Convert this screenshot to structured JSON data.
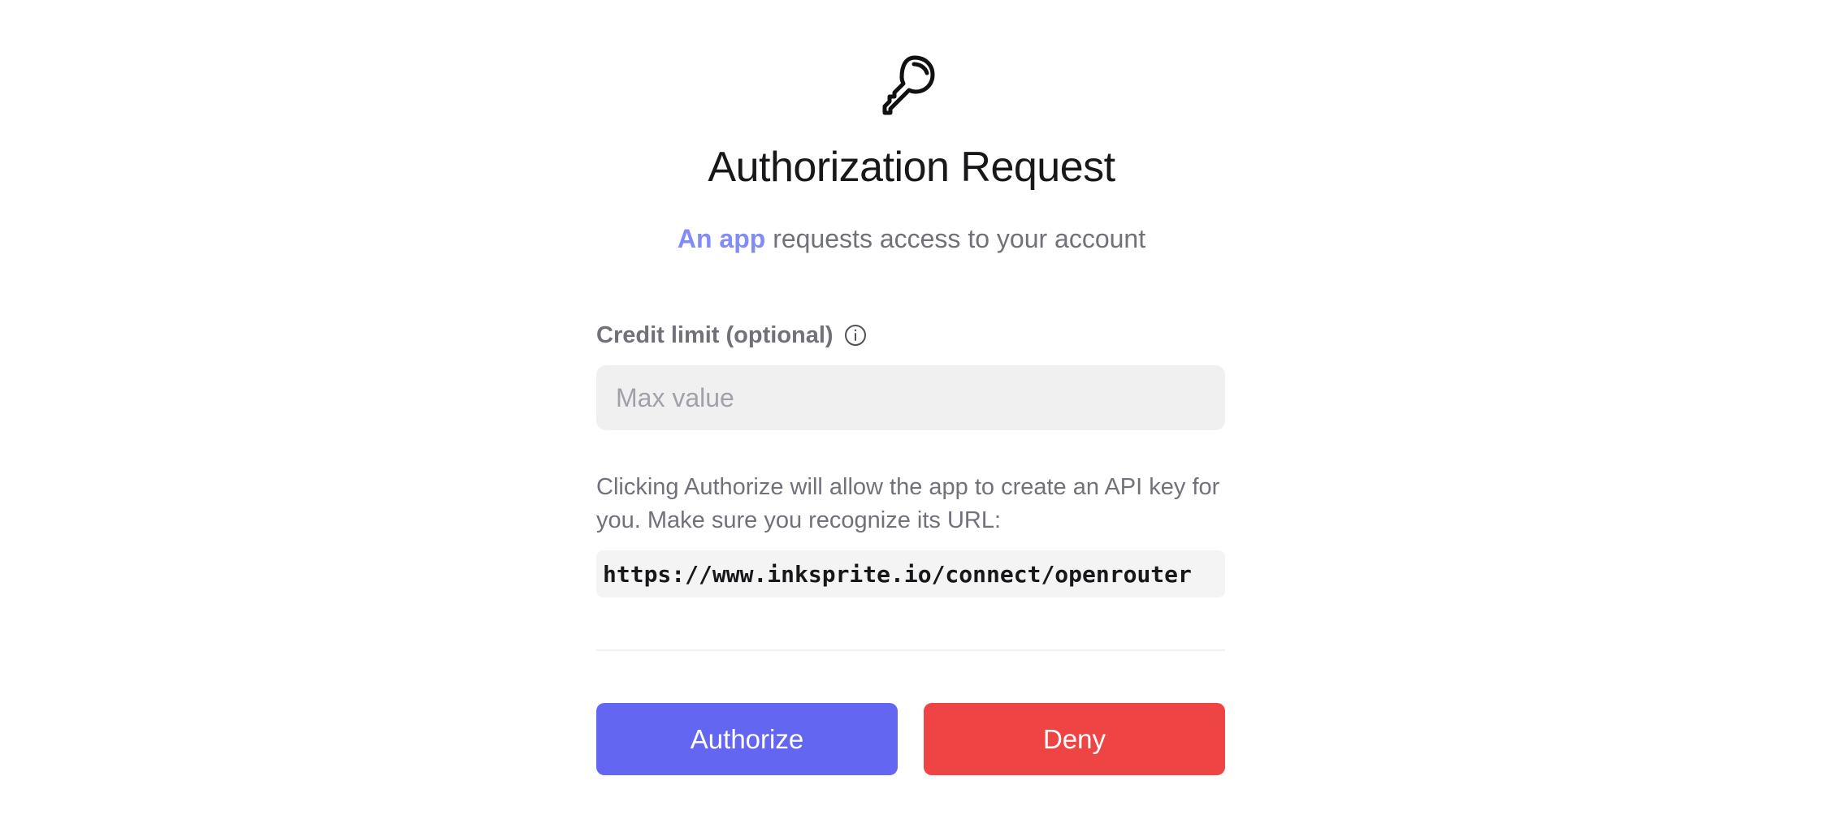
{
  "header": {
    "icon": "key-icon",
    "title": "Authorization Request",
    "subtitle_app": "An app",
    "subtitle_rest": " requests access to your account"
  },
  "form": {
    "credit_label": "Credit limit (optional)",
    "info_icon": "info-icon",
    "credit_placeholder": "Max value",
    "credit_value": "",
    "description": "Clicking Authorize will allow the app to create an API key for you. Make sure you recognize its URL:",
    "url": "https://www.inksprite.io/connect/openrouter"
  },
  "actions": {
    "authorize_label": "Authorize",
    "deny_label": "Deny"
  },
  "colors": {
    "accent": "#6366f1",
    "app_link": "#818cf8",
    "deny": "#ef4444",
    "muted_text": "#71717a"
  }
}
